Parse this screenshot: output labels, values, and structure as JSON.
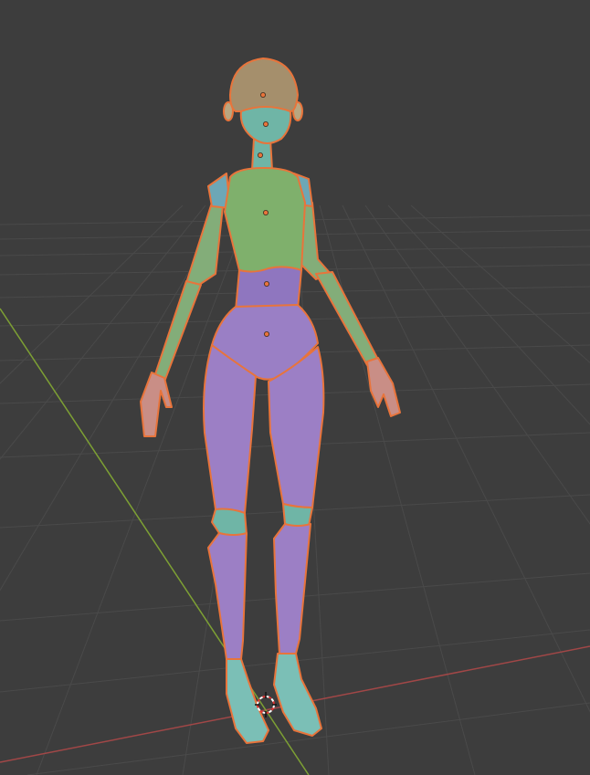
{
  "viewport": {
    "background": "#3d3d3d",
    "grid_color": "#4a4a4a",
    "x_axis_color": "#a14747",
    "y_axis_color": "#7da034",
    "selection_outline": "#e8743b",
    "origin_dot": "#e8743b"
  },
  "model": {
    "parts": [
      {
        "name": "head",
        "color": "#a58f6c"
      },
      {
        "name": "face",
        "color": "#6fb5a6"
      },
      {
        "name": "ears",
        "color": "#b9a681"
      },
      {
        "name": "neck",
        "color": "#6fb5a6"
      },
      {
        "name": "chest",
        "color": "#7fb06c"
      },
      {
        "name": "shoulders",
        "color": "#6da7b6"
      },
      {
        "name": "arms",
        "color": "#83ad79"
      },
      {
        "name": "hands",
        "color": "#c98e86"
      },
      {
        "name": "waist",
        "color": "#8f76bf"
      },
      {
        "name": "pelvis",
        "color": "#9a7fc5"
      },
      {
        "name": "legs",
        "color": "#9c7fc5"
      },
      {
        "name": "knees",
        "color": "#6fb5a6"
      },
      {
        "name": "feet",
        "color": "#7bbfb6"
      }
    ]
  },
  "cursor_3d": {
    "icon": "3d-cursor-icon"
  }
}
